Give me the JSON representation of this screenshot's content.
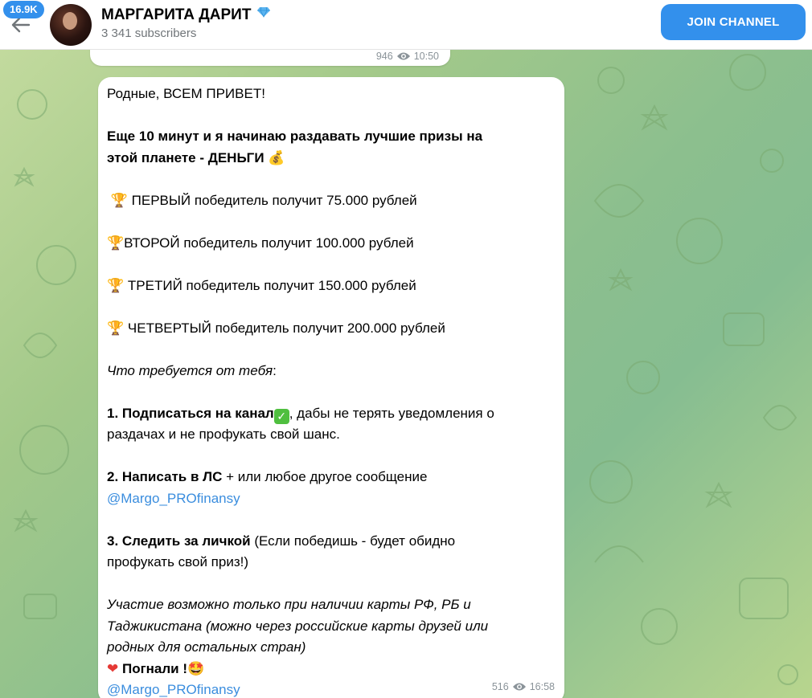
{
  "header": {
    "unread_count": "16.9K",
    "channel_title": "МАРГАРИТА ДАРИТ",
    "subscribers": "3 341 subscribers",
    "join_label": "JOIN CHANNEL"
  },
  "previous_message": {
    "views": "946",
    "time": "10:50"
  },
  "message": {
    "greeting": "Родные, ВСЕМ ПРИВЕТ!",
    "intro_line1": "Еще 10 минут и я начинаю раздавать лучшие призы на",
    "intro_line2": "этой планете - ДЕНЬГИ",
    "prize1": "ПЕРВЫЙ победитель получит 75.000 рублей",
    "prize2": "ВТОРОЙ победитель получит 100.000 рублей",
    "prize3": "ТРЕТИЙ победитель получит 150.000 рублей",
    "prize4": "ЧЕТВЕРТЫЙ победитель получит 200.000 рублей",
    "requirements_heading": "Что требуется от тебя",
    "step1_bold": "1. Подписаться на канал",
    "step1_rest": ", дабы не терять уведомления о",
    "step1_line2": "раздачах и не профукать свой шанс.",
    "step2_bold": "2. Написать в ЛС",
    "step2_rest": " + или любое другое сообщение",
    "step2_link": "@Margo_PROfinansy",
    "step3_bold": "3. Следить за личкой",
    "step3_rest": " (Если победишь - будет обидно",
    "step3_line2": "профукать свой приз!)",
    "note_line1": "Участие возможно только при наличии карты РФ, РБ и",
    "note_line2": "Таджикистана (можно через российские карты друзей или",
    "note_line3": "родных для остальных стран)",
    "closing": " Погнали !",
    "closing_link": "@Margo_PROfinansy",
    "views": "516",
    "time": "16:58"
  },
  "icons": {
    "back": "arrow-left-icon",
    "verified": "diamond-icon",
    "views": "eye-icon",
    "trophy": "trophy-icon",
    "money_bag": "money-bag-icon",
    "check": "check-mark-icon",
    "heart": "heart-icon",
    "star_struck": "star-struck-icon"
  },
  "colors": {
    "accent": "#3390ec",
    "link": "#3a8dde",
    "meta": "#8a9399"
  }
}
